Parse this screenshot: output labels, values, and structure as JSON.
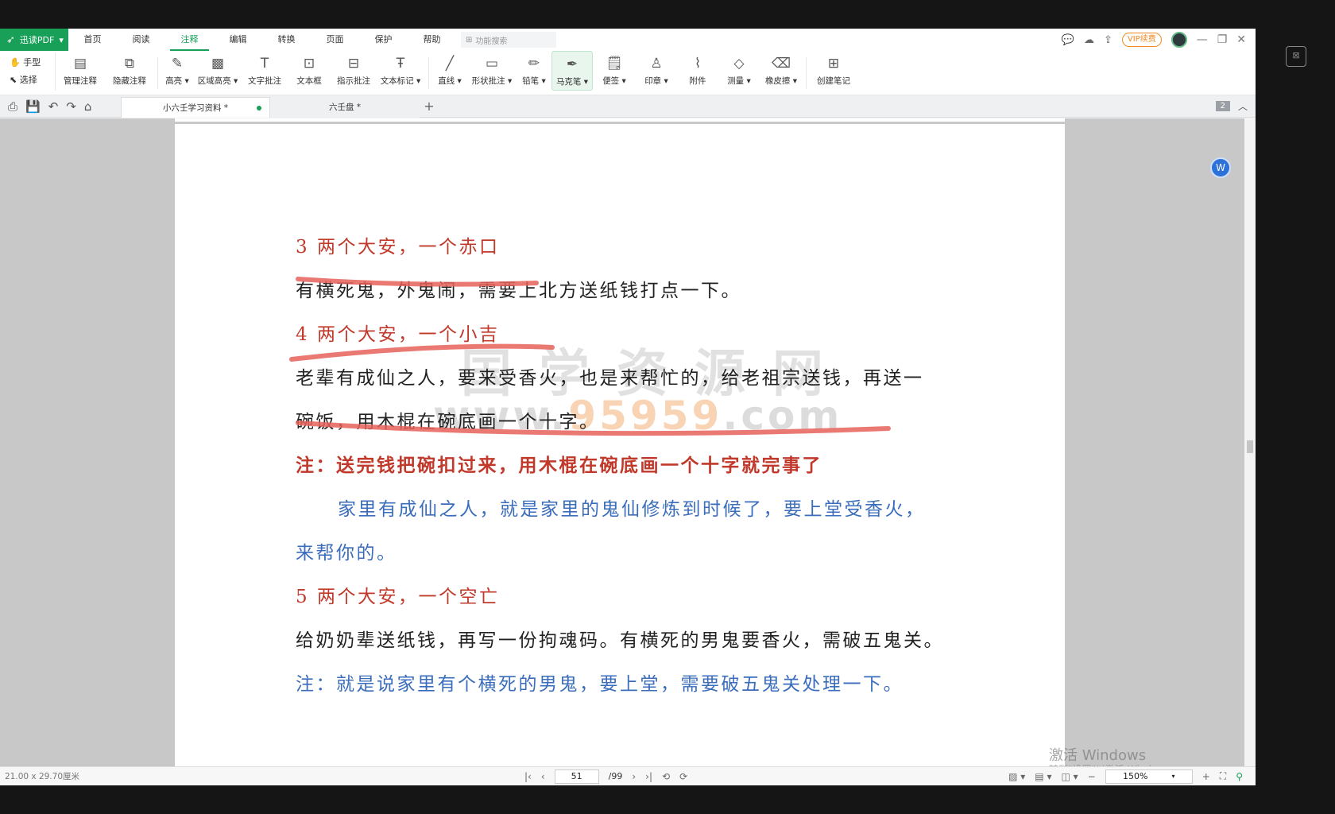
{
  "app": {
    "brand": "迅读PDF",
    "brand_dropdown": "▾",
    "menu": [
      "首页",
      "阅读",
      "注释",
      "编辑",
      "转换",
      "页面",
      "保护",
      "帮助"
    ],
    "active_menu": "注释",
    "search_placeholder": "功能搜索",
    "vip_label": "VIP续费"
  },
  "toolbar": {
    "hand": "手型",
    "select": "选择",
    "tools": [
      {
        "label": "管理注释",
        "icon": "manage-annotations-icon"
      },
      {
        "label": "隐藏注释",
        "icon": "hide-annotations-icon"
      },
      {
        "label": "高亮 ▾",
        "icon": "highlight-icon"
      },
      {
        "label": "区域高亮 ▾",
        "icon": "area-highlight-icon"
      },
      {
        "label": "文字批注",
        "icon": "text-comment-icon"
      },
      {
        "label": "文本框",
        "icon": "textbox-icon"
      },
      {
        "label": "指示批注",
        "icon": "callout-icon"
      },
      {
        "label": "文本标记 ▾",
        "icon": "text-markup-icon"
      },
      {
        "label": "直线 ▾",
        "icon": "line-icon"
      },
      {
        "label": "形状批注 ▾",
        "icon": "shape-icon"
      },
      {
        "label": "铅笔 ▾",
        "icon": "pencil-icon"
      },
      {
        "label": "马克笔 ▾",
        "icon": "marker-icon"
      },
      {
        "label": "便签 ▾",
        "icon": "sticky-note-icon"
      },
      {
        "label": "印章 ▾",
        "icon": "stamp-icon"
      },
      {
        "label": "附件",
        "icon": "attachment-icon"
      },
      {
        "label": "测量 ▾",
        "icon": "measure-icon"
      },
      {
        "label": "橡皮擦 ▾",
        "icon": "eraser-icon"
      },
      {
        "label": "创建笔记",
        "icon": "create-note-icon"
      }
    ],
    "active_tool": "马克笔 ▾"
  },
  "tabs": [
    {
      "label": "小六壬学习资料 *",
      "active": true
    },
    {
      "label": "六壬盘 *",
      "active": false
    }
  ],
  "page_badge": "2",
  "document": {
    "lines": [
      {
        "text": "3 两个大安，一个赤口",
        "style": "red"
      },
      {
        "text": "有横死鬼，外鬼闹，需要上北方送纸钱打点一下。",
        "style": "black"
      },
      {
        "text": "4 两个大安，一个小吉",
        "style": "red"
      },
      {
        "text": "老辈有成仙之人，要来受香火，也是来帮忙的，给老祖宗送钱，再送一",
        "style": "black"
      },
      {
        "text": "碗饭，用木棍在碗底画一个十字。",
        "style": "black"
      },
      {
        "text": "注：送完钱把碗扣过来，用木棍在碗底画一个十字就完事了",
        "style": "red bold"
      },
      {
        "text": "家里有成仙之人，就是家里的鬼仙修炼到时候了，要上堂受香火，",
        "style": "blue indent"
      },
      {
        "text": "来帮你的。",
        "style": "blue"
      },
      {
        "text": "5 两个大安，一个空亡",
        "style": "red"
      },
      {
        "text": "给奶奶辈送纸钱，再写一份拘魂码。有横死的男鬼要香火，需破五鬼关。",
        "style": "black"
      },
      {
        "text": "注：就是说家里有个横死的男鬼，要上堂，需要破五鬼关处理一下。",
        "style": "blue"
      }
    ],
    "watermark_cn": "国学资源网",
    "watermark_url_a": "www.",
    "watermark_url_num": "95959",
    "watermark_url_b": ".com"
  },
  "windows_notice": {
    "title": "激活 Windows",
    "subtitle": "转到\"设置\"以激活 Windows。"
  },
  "status": {
    "dimensions": "21.00 x 29.70厘米",
    "current_page": "51",
    "total_pages": "/99",
    "zoom": "150%"
  },
  "colors": {
    "brand_green": "#18a058",
    "heading_red": "#c0392b",
    "note_blue": "#3a6dbb",
    "marker_red": "#e8625a"
  }
}
